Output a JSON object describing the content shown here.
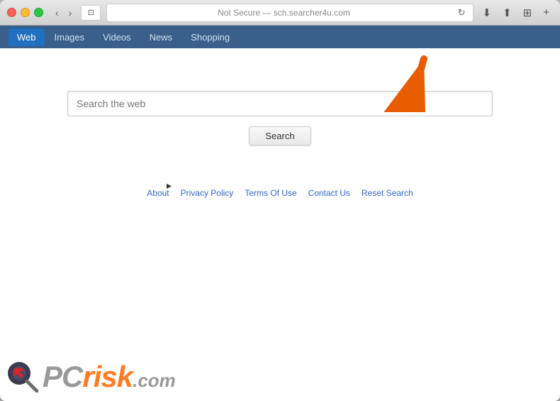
{
  "browser": {
    "title": "Not Secure — sch.searcher4u.com",
    "not_secure_label": "Not Secure — sch.searcher4u.com",
    "tab_icon": "⊡"
  },
  "nav": {
    "tabs": [
      {
        "id": "web",
        "label": "Web",
        "active": true
      },
      {
        "id": "images",
        "label": "Images",
        "active": false
      },
      {
        "id": "videos",
        "label": "Videos",
        "active": false
      },
      {
        "id": "news",
        "label": "News",
        "active": false
      },
      {
        "id": "shopping",
        "label": "Shopping",
        "active": false
      }
    ]
  },
  "search": {
    "placeholder": "Search the web",
    "button_label": "Search"
  },
  "footer": {
    "links": [
      {
        "label": "About",
        "href": "#"
      },
      {
        "label": "Privacy Policy",
        "href": "#"
      },
      {
        "label": "Terms Of Use",
        "href": "#"
      },
      {
        "label": "Contact Us",
        "href": "#"
      },
      {
        "label": "Reset Search",
        "href": "#"
      }
    ]
  },
  "watermark": {
    "pc": "PC",
    "risk": "risk",
    "dotcom": ".com"
  },
  "icons": {
    "back": "‹",
    "forward": "›",
    "reload": "↻",
    "download": "⬇",
    "share": "⬆",
    "tab_manage": "⊞",
    "add_tab": "+"
  }
}
